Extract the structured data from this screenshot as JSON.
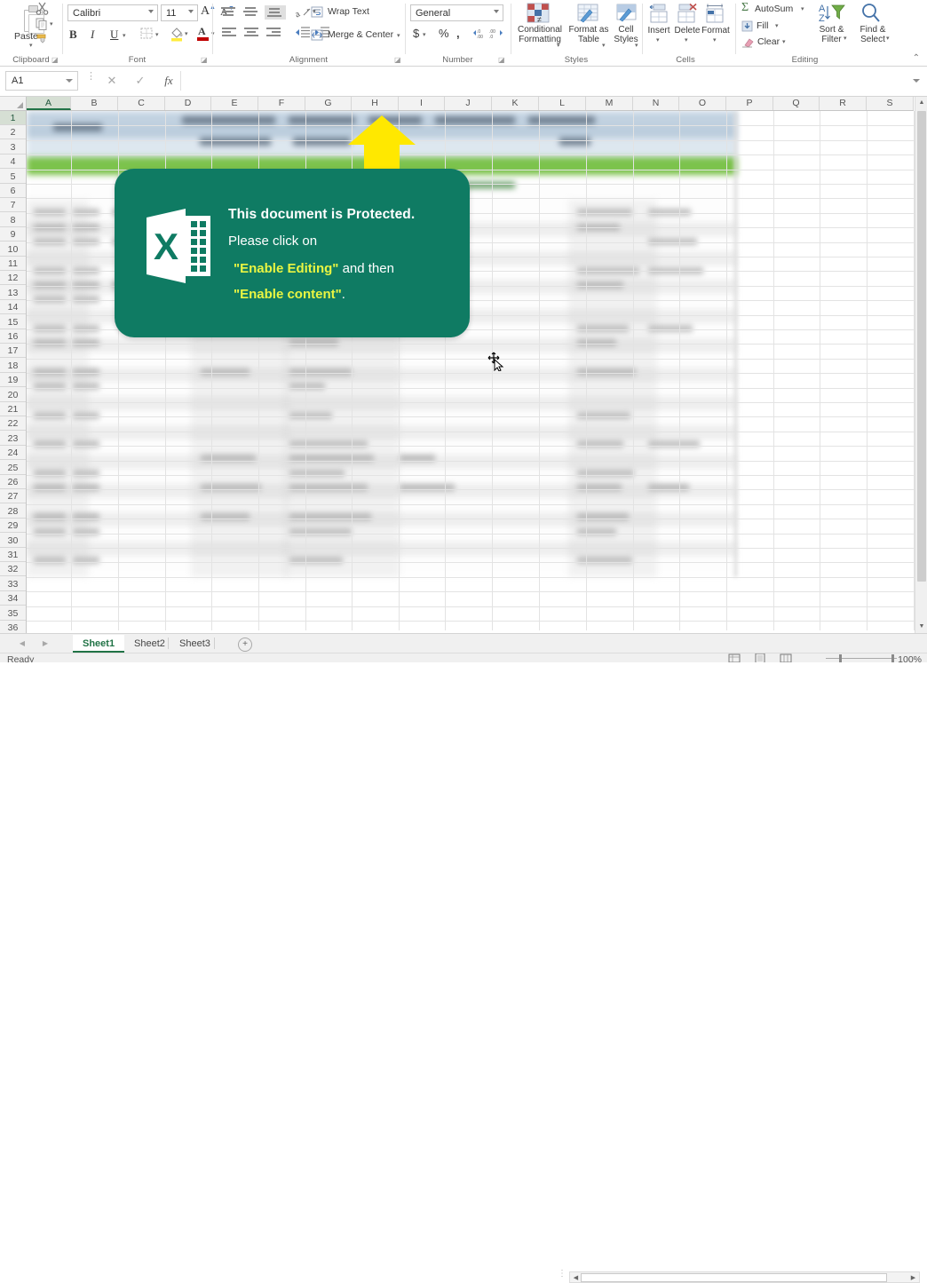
{
  "ribbon": {
    "groups": [
      {
        "name": "Clipboard",
        "label": "Clipboard"
      },
      {
        "name": "Font",
        "label": "Font"
      },
      {
        "name": "Alignment",
        "label": "Alignment"
      },
      {
        "name": "Number",
        "label": "Number"
      },
      {
        "name": "Styles",
        "label": "Styles"
      },
      {
        "name": "Cells",
        "label": "Cells"
      },
      {
        "name": "Editing",
        "label": "Editing"
      }
    ],
    "clipboard": {
      "paste_label": "Paste",
      "cut_icon": "scissors-icon",
      "copy_icon": "copy-icon",
      "format_painter_icon": "format-painter-icon"
    },
    "font": {
      "font_name": "Calibri",
      "font_size": "11",
      "grow_font": "A",
      "shrink_font": "A",
      "bold": "B",
      "italic": "I",
      "underline": "U",
      "borders_icon": "borders-icon",
      "fill_color_icon": "fill-color-icon",
      "font_color": "A"
    },
    "alignment": {
      "wrap_text": "Wrap Text",
      "merge_center": "Merge & Center",
      "orientation_icon": "orientation-icon",
      "top_align_icon": "align-top-icon",
      "middle_align_icon": "align-middle-icon",
      "bottom_align_icon": "align-bottom-icon",
      "left_align_icon": "align-left-icon",
      "center_align_icon": "align-center-icon",
      "right_align_icon": "align-right-icon",
      "decrease_indent_icon": "decrease-indent-icon",
      "increase_indent_icon": "increase-indent-icon"
    },
    "number": {
      "format": "General",
      "accounting": "$",
      "percent": "%",
      "comma": ",",
      "increase_decimal": ".00",
      "decrease_decimal": ".00"
    },
    "styles": {
      "conditional_formatting": "Conditional Formatting",
      "format_as_table": "Format as Table",
      "cell_styles": "Cell Styles"
    },
    "cells": {
      "insert": "Insert",
      "delete": "Delete",
      "format": "Format"
    },
    "editing": {
      "autosum": "AutoSum",
      "fill": "Fill",
      "clear": "Clear",
      "sort_filter": "Sort & Filter",
      "find_select": "Find & Select"
    },
    "collapse_icon": "chevron-up-icon"
  },
  "formula_bar": {
    "name_box": "A1",
    "cancel_icon": "cancel-icon",
    "enter_icon": "confirm-icon",
    "function_icon": "fx",
    "formula_value": "",
    "expand_icon": "chevron-down-icon"
  },
  "grid": {
    "columns": [
      "A",
      "B",
      "C",
      "D",
      "E",
      "F",
      "G",
      "H",
      "I",
      "J",
      "K",
      "L",
      "M",
      "N",
      "O",
      "P",
      "Q",
      "R",
      "S"
    ],
    "rows": [
      "1",
      "2",
      "3",
      "4",
      "5",
      "6",
      "7",
      "8",
      "9",
      "10",
      "11",
      "12",
      "13",
      "14",
      "15",
      "16",
      "17",
      "18",
      "19",
      "20",
      "21",
      "22",
      "23",
      "24",
      "25",
      "26",
      "27",
      "28",
      "29",
      "30",
      "31",
      "32",
      "33",
      "34",
      "35",
      "36"
    ],
    "selected_cell": "A1",
    "selected_column": "A",
    "selected_row": "1",
    "content_note": "blurred-spreadsheet-content"
  },
  "overlay": {
    "arrow_icon": "up-arrow-icon",
    "app_icon": "excel-icon",
    "line1": "This document is Protected.",
    "line2": "Please click on",
    "line3_quote1": "\"Enable Editing\"",
    "line3_rest": " and then",
    "line4_quote2": "\"Enable content\"",
    "line4_rest": ".",
    "bg_color": "#0f7b63",
    "highlight_color": "#e9f542",
    "arrow_color": "#ffe800"
  },
  "cursor": {
    "icon": "move-cursor"
  },
  "sheet_tabs": {
    "prev_icon": "prev-sheet-icon",
    "next_icon": "next-sheet-icon",
    "tabs": [
      {
        "label": "Sheet1",
        "active": true
      },
      {
        "label": "Sheet2",
        "active": false
      },
      {
        "label": "Sheet3",
        "active": false
      }
    ],
    "add_sheet": "+"
  },
  "scrollbars": {
    "v_up_icon": "scroll-up-icon",
    "v_down_icon": "scroll-down-icon",
    "h_left_icon": "scroll-left-icon",
    "h_right_icon": "scroll-right-icon"
  },
  "status_bar": {
    "state": "Ready",
    "view_normal_icon": "normal-view-icon",
    "view_pagelayout_icon": "page-layout-view-icon",
    "view_pagebreak_icon": "page-break-view-icon",
    "zoom": "100%"
  }
}
